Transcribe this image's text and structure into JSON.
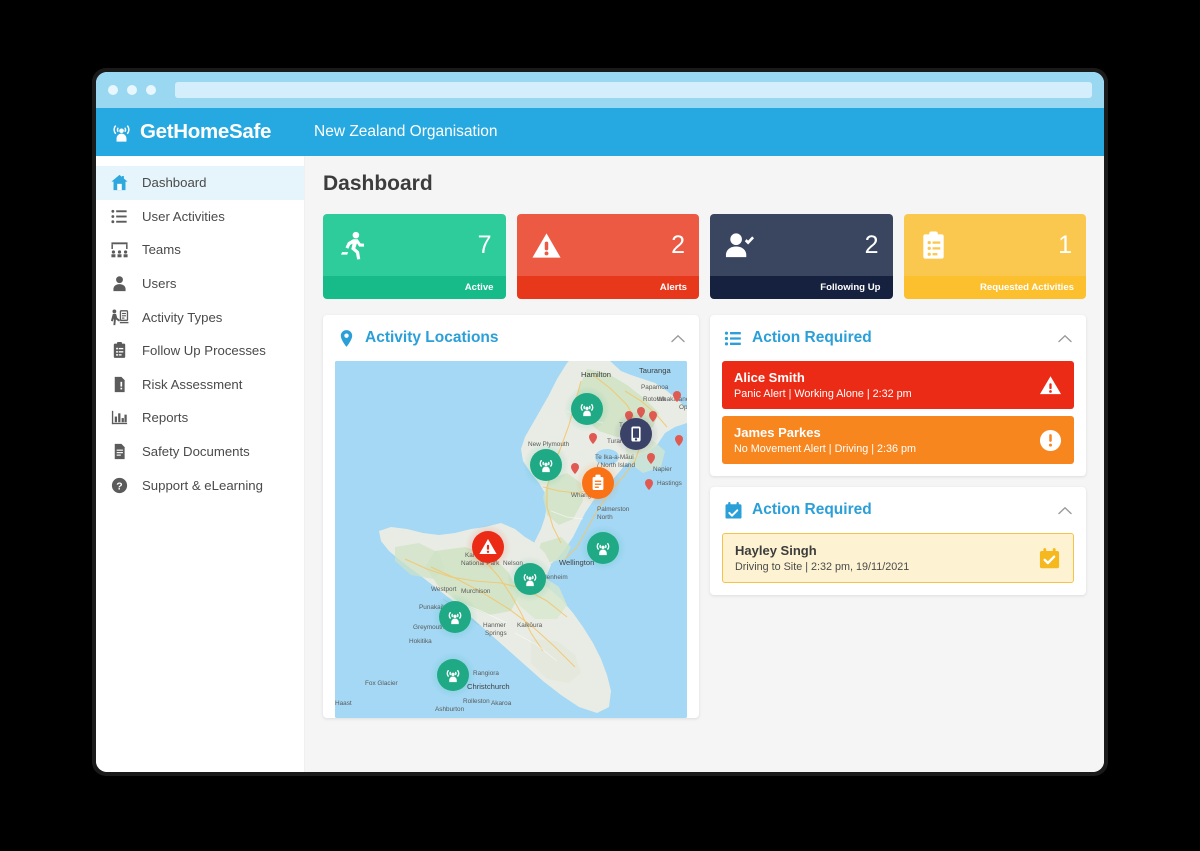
{
  "browser": {
    "dots": [
      "close-dot",
      "minimize-dot",
      "maximize-dot"
    ],
    "address_value": ""
  },
  "header": {
    "brand": "GetHomeSafe",
    "brand_icon": "signal-person-icon",
    "org_name": "New Zealand Organisation",
    "bg_color": "#26a9e0"
  },
  "sidebar": {
    "items": [
      {
        "label": "Dashboard",
        "icon": "home-icon",
        "active": true
      },
      {
        "label": "User Activities",
        "icon": "list-icon",
        "active": false
      },
      {
        "label": "Teams",
        "icon": "teams-icon",
        "active": false
      },
      {
        "label": "Users",
        "icon": "user-icon",
        "active": false
      },
      {
        "label": "Activity Types",
        "icon": "activity-types-icon",
        "active": false
      },
      {
        "label": "Follow Up Processes",
        "icon": "clipboard-check-icon",
        "active": false
      },
      {
        "label": "Risk Assessment",
        "icon": "risk-document-icon",
        "active": false
      },
      {
        "label": "Reports",
        "icon": "bar-chart-icon",
        "active": false
      },
      {
        "label": "Safety Documents",
        "icon": "document-icon",
        "active": false
      },
      {
        "label": "Support & eLearning",
        "icon": "question-circle-icon",
        "active": false
      }
    ]
  },
  "main": {
    "page_title": "Dashboard",
    "stats": [
      {
        "value": "7",
        "label": "Active",
        "icon": "running-person-icon",
        "top_color": "#2ecc9b",
        "foot_color": "#17bb8a"
      },
      {
        "value": "2",
        "label": "Alerts",
        "icon": "warning-triangle-icon",
        "top_color": "#ec5a43",
        "foot_color": "#e8381c"
      },
      {
        "value": "2",
        "label": "Following Up",
        "icon": "user-check-icon",
        "top_color": "#3a4560",
        "foot_color": "#16213f"
      },
      {
        "value": "1",
        "label": "Requested Activities",
        "icon": "clipboard-list-icon",
        "top_color": "#fbc84f",
        "foot_color": "#fcc02e"
      }
    ],
    "map_panel": {
      "title": "Activity Locations",
      "icon": "map-pin-icon",
      "collapse_icon": "chevron-up-icon",
      "map_labels": [
        "Hamilton",
        "Tauranga",
        "Papamoa",
        "Whakatane",
        "Opotiki",
        "Rotorua",
        "Taupo",
        "New Plymouth",
        "Turangi",
        "Napier",
        "Hastings",
        "Te Ika-a-Maui / North Island",
        "Whanganui",
        "Palmerston North",
        "Wellington",
        "Nelson",
        "Kahurangi National Park",
        "Blenheim",
        "Westport",
        "Murchison",
        "Kaikoura",
        "Punakaiki",
        "Hanmer Springs",
        "Greymouth",
        "Hokitika",
        "Rangiora",
        "Christchurch",
        "Rolleston",
        "Akaroa",
        "Fox Glacier",
        "Ashburton",
        "Haast"
      ],
      "markers": [
        {
          "type": "activity",
          "color": "#1faa85",
          "icon": "signal-person-icon"
        },
        {
          "type": "activity",
          "color": "#1faa85",
          "icon": "signal-person-icon"
        },
        {
          "type": "activity",
          "color": "#1faa85",
          "icon": "signal-person-icon"
        },
        {
          "type": "activity",
          "color": "#1faa85",
          "icon": "signal-person-icon"
        },
        {
          "type": "activity",
          "color": "#1faa85",
          "icon": "signal-person-icon"
        },
        {
          "type": "activity",
          "color": "#1faa85",
          "icon": "signal-person-icon"
        },
        {
          "type": "following-up",
          "color": "#3a4268",
          "icon": "phone-icon"
        },
        {
          "type": "requested",
          "color": "#f97316",
          "icon": "clipboard-icon"
        },
        {
          "type": "alert",
          "color": "#ec2b16",
          "icon": "warning-triangle-icon"
        }
      ]
    },
    "alerts_panel": {
      "title": "Action Required",
      "icon": "list-icon",
      "collapse_icon": "chevron-up-icon",
      "rows": [
        {
          "name": "Alice Smith",
          "detail": "Panic Alert | Working Alone | 2:32 pm",
          "style": "alert-red",
          "badge_icon": "warning-triangle-icon"
        },
        {
          "name": "James Parkes",
          "detail": "No Movement Alert | Driving | 2:36 pm",
          "style": "alert-orange",
          "badge_icon": "exclamation-circle-icon"
        }
      ]
    },
    "requests_panel": {
      "title": "Action Required",
      "icon": "calendar-check-icon",
      "collapse_icon": "chevron-up-icon",
      "rows": [
        {
          "name": "Hayley Singh",
          "detail": "Driving to Site | 2:32 pm, 19/11/2021",
          "style": "alert-yellow",
          "badge_icon": "calendar-check-icon"
        }
      ]
    }
  }
}
